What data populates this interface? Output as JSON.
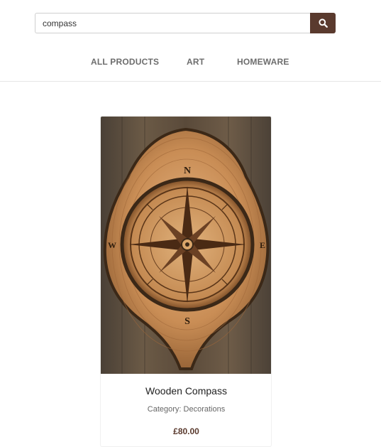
{
  "search": {
    "value": "compass",
    "button_icon": "search-icon"
  },
  "nav": {
    "items": [
      {
        "label": "ALL PRODUCTS"
      },
      {
        "label": "ART"
      },
      {
        "label": "HOMEWARE"
      }
    ]
  },
  "product": {
    "title": "Wooden Compass",
    "category": "Category: Decorations",
    "price": "£80.00",
    "image_icon": "wooden-compass-image"
  },
  "colors": {
    "accent": "#5a3a2e",
    "nav_text": "#6d6d6d",
    "divider": "#e6e6e6"
  }
}
